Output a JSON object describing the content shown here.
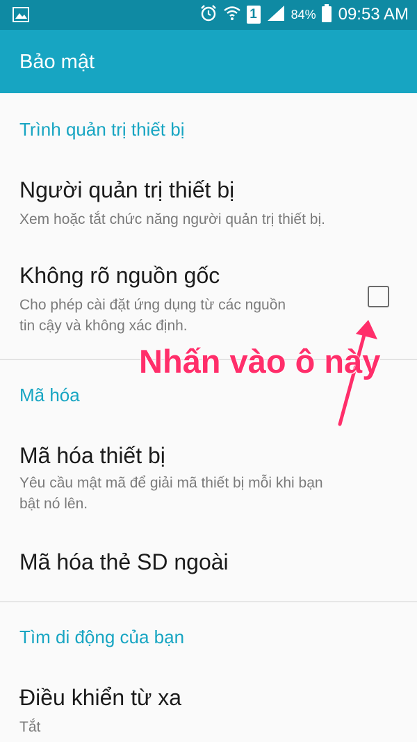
{
  "status_bar": {
    "battery": "84%",
    "time": "09:53 AM",
    "sim_slot": "1",
    "icons": [
      "image-icon",
      "alarm-icon",
      "wifi-icon",
      "sim-icon",
      "signal-icon",
      "battery-icon"
    ]
  },
  "app_bar": {
    "title": "Bảo mật"
  },
  "sections": [
    {
      "header": "Trình quản trị thiết bị",
      "items": [
        {
          "title": "Người quản trị thiết bị",
          "subtitle": "Xem hoặc tắt chức năng người quản trị thiết bị."
        },
        {
          "title": "Không rõ nguồn gốc",
          "subtitle_lines": [
            "Cho phép cài đặt ứng dụng từ các nguồn",
            "tin cậy và không xác định."
          ],
          "checked": false
        }
      ]
    },
    {
      "header": "Mã hóa",
      "items": [
        {
          "title": "Mã hóa thiết bị",
          "subtitle_lines": [
            "Yêu cầu mật mã để giải mã thiết bị mỗi khi bạn",
            "bật nó lên."
          ]
        },
        {
          "title": "Mã hóa thẻ SD ngoài"
        }
      ]
    },
    {
      "header": "Tìm di động của bạn",
      "items": [
        {
          "title": "Điều khiển từ xa",
          "subtitle": "Tắt"
        }
      ]
    }
  ],
  "annotation": {
    "text": "Nhấn vào ô này",
    "color": "#ff2e6a"
  },
  "colors": {
    "status_bar": "#0f8aa3",
    "app_bar": "#17a5c2",
    "accent": "#17a5c2"
  }
}
